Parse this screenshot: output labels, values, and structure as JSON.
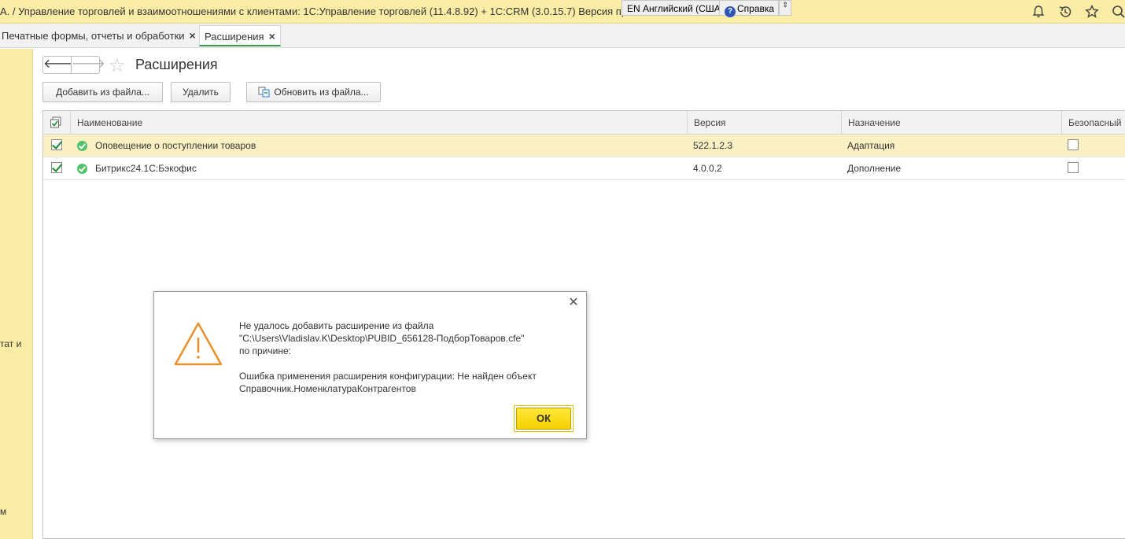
{
  "window": {
    "title": "А. / Управление торговлей и взаимоотношениями с клиентами: 1С:Управление торговлей (11.4.8.92) + 1С:CRM (3.0.15.7) Версия пр",
    "language_indicator": "EN Английский (США)",
    "help_label": "Справка",
    "help_arrow": "⇕"
  },
  "tabs": [
    {
      "label": "Печатные формы, отчеты и обработки",
      "close": "×"
    },
    {
      "label": "Расширения",
      "close": "×"
    }
  ],
  "left_panel": {
    "fragments": [
      "тат и",
      "м"
    ]
  },
  "page": {
    "title": "Расширения",
    "back_glyph": "🡐",
    "forward_glyph": "🡒",
    "star_glyph": "☆"
  },
  "toolbar": {
    "add_label": "Добавить из файла...",
    "delete_label": "Удалить",
    "update_label": "Обновить из файла..."
  },
  "table": {
    "columns": [
      "Наименование",
      "Версия",
      "Назначение",
      "Безопасный"
    ],
    "rows": [
      {
        "active": true,
        "name": "Оповещение о поступлении товаров",
        "version": "522.1.2.3",
        "purpose": "Адаптация",
        "safe": false
      },
      {
        "active": true,
        "name": "Битрикс24.1С:Бэкофис",
        "version": "4.0.0.2",
        "purpose": "Дополнение",
        "safe": false
      }
    ]
  },
  "dialog": {
    "close_glyph": "✕",
    "lines": [
      "Не удалось добавить расширение из файла",
      "\"C:\\Users\\Vladislav.K\\Desktop\\PUBID_656128-ПодборТоваров.cfe\"",
      "по причине:",
      "",
      "Ошибка применения расширения конфигурации: Не найден объект",
      "Справочник.НоменклатураКонтрагентов"
    ],
    "ok_label": "ОК"
  },
  "colors": {
    "title_bar": "#fbeda6",
    "accent_green": "#3a9b4a",
    "selected_row": "#fbf0c4",
    "ok_button": "#f5d100",
    "warning_orange": "#e8912a"
  },
  "icons": {
    "titlebar": [
      "bell-icon",
      "history-icon",
      "star-icon",
      "search-icon"
    ],
    "warning": "warning-triangle-icon",
    "status_ok": "check-circle-icon"
  }
}
